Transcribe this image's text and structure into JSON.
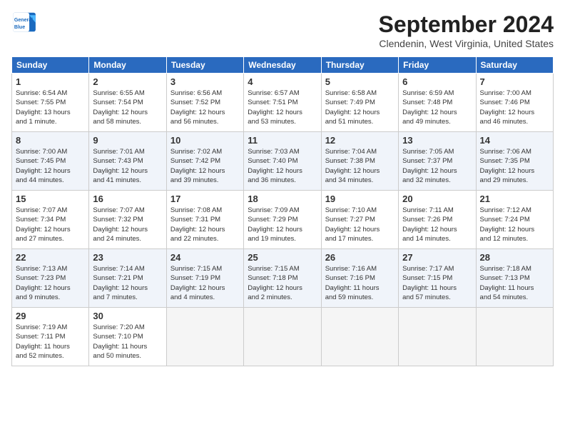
{
  "header": {
    "logo_line1": "General",
    "logo_line2": "Blue",
    "month": "September 2024",
    "location": "Clendenin, West Virginia, United States"
  },
  "columns": [
    "Sunday",
    "Monday",
    "Tuesday",
    "Wednesday",
    "Thursday",
    "Friday",
    "Saturday"
  ],
  "weeks": [
    [
      {
        "day": "1",
        "info": "Sunrise: 6:54 AM\nSunset: 7:55 PM\nDaylight: 13 hours\nand 1 minute."
      },
      {
        "day": "2",
        "info": "Sunrise: 6:55 AM\nSunset: 7:54 PM\nDaylight: 12 hours\nand 58 minutes."
      },
      {
        "day": "3",
        "info": "Sunrise: 6:56 AM\nSunset: 7:52 PM\nDaylight: 12 hours\nand 56 minutes."
      },
      {
        "day": "4",
        "info": "Sunrise: 6:57 AM\nSunset: 7:51 PM\nDaylight: 12 hours\nand 53 minutes."
      },
      {
        "day": "5",
        "info": "Sunrise: 6:58 AM\nSunset: 7:49 PM\nDaylight: 12 hours\nand 51 minutes."
      },
      {
        "day": "6",
        "info": "Sunrise: 6:59 AM\nSunset: 7:48 PM\nDaylight: 12 hours\nand 49 minutes."
      },
      {
        "day": "7",
        "info": "Sunrise: 7:00 AM\nSunset: 7:46 PM\nDaylight: 12 hours\nand 46 minutes."
      }
    ],
    [
      {
        "day": "8",
        "info": "Sunrise: 7:00 AM\nSunset: 7:45 PM\nDaylight: 12 hours\nand 44 minutes."
      },
      {
        "day": "9",
        "info": "Sunrise: 7:01 AM\nSunset: 7:43 PM\nDaylight: 12 hours\nand 41 minutes."
      },
      {
        "day": "10",
        "info": "Sunrise: 7:02 AM\nSunset: 7:42 PM\nDaylight: 12 hours\nand 39 minutes."
      },
      {
        "day": "11",
        "info": "Sunrise: 7:03 AM\nSunset: 7:40 PM\nDaylight: 12 hours\nand 36 minutes."
      },
      {
        "day": "12",
        "info": "Sunrise: 7:04 AM\nSunset: 7:38 PM\nDaylight: 12 hours\nand 34 minutes."
      },
      {
        "day": "13",
        "info": "Sunrise: 7:05 AM\nSunset: 7:37 PM\nDaylight: 12 hours\nand 32 minutes."
      },
      {
        "day": "14",
        "info": "Sunrise: 7:06 AM\nSunset: 7:35 PM\nDaylight: 12 hours\nand 29 minutes."
      }
    ],
    [
      {
        "day": "15",
        "info": "Sunrise: 7:07 AM\nSunset: 7:34 PM\nDaylight: 12 hours\nand 27 minutes."
      },
      {
        "day": "16",
        "info": "Sunrise: 7:07 AM\nSunset: 7:32 PM\nDaylight: 12 hours\nand 24 minutes."
      },
      {
        "day": "17",
        "info": "Sunrise: 7:08 AM\nSunset: 7:31 PM\nDaylight: 12 hours\nand 22 minutes."
      },
      {
        "day": "18",
        "info": "Sunrise: 7:09 AM\nSunset: 7:29 PM\nDaylight: 12 hours\nand 19 minutes."
      },
      {
        "day": "19",
        "info": "Sunrise: 7:10 AM\nSunset: 7:27 PM\nDaylight: 12 hours\nand 17 minutes."
      },
      {
        "day": "20",
        "info": "Sunrise: 7:11 AM\nSunset: 7:26 PM\nDaylight: 12 hours\nand 14 minutes."
      },
      {
        "day": "21",
        "info": "Sunrise: 7:12 AM\nSunset: 7:24 PM\nDaylight: 12 hours\nand 12 minutes."
      }
    ],
    [
      {
        "day": "22",
        "info": "Sunrise: 7:13 AM\nSunset: 7:23 PM\nDaylight: 12 hours\nand 9 minutes."
      },
      {
        "day": "23",
        "info": "Sunrise: 7:14 AM\nSunset: 7:21 PM\nDaylight: 12 hours\nand 7 minutes."
      },
      {
        "day": "24",
        "info": "Sunrise: 7:15 AM\nSunset: 7:19 PM\nDaylight: 12 hours\nand 4 minutes."
      },
      {
        "day": "25",
        "info": "Sunrise: 7:15 AM\nSunset: 7:18 PM\nDaylight: 12 hours\nand 2 minutes."
      },
      {
        "day": "26",
        "info": "Sunrise: 7:16 AM\nSunset: 7:16 PM\nDaylight: 11 hours\nand 59 minutes."
      },
      {
        "day": "27",
        "info": "Sunrise: 7:17 AM\nSunset: 7:15 PM\nDaylight: 11 hours\nand 57 minutes."
      },
      {
        "day": "28",
        "info": "Sunrise: 7:18 AM\nSunset: 7:13 PM\nDaylight: 11 hours\nand 54 minutes."
      }
    ],
    [
      {
        "day": "29",
        "info": "Sunrise: 7:19 AM\nSunset: 7:11 PM\nDaylight: 11 hours\nand 52 minutes."
      },
      {
        "day": "30",
        "info": "Sunrise: 7:20 AM\nSunset: 7:10 PM\nDaylight: 11 hours\nand 50 minutes."
      },
      {
        "day": "",
        "info": ""
      },
      {
        "day": "",
        "info": ""
      },
      {
        "day": "",
        "info": ""
      },
      {
        "day": "",
        "info": ""
      },
      {
        "day": "",
        "info": ""
      }
    ]
  ]
}
